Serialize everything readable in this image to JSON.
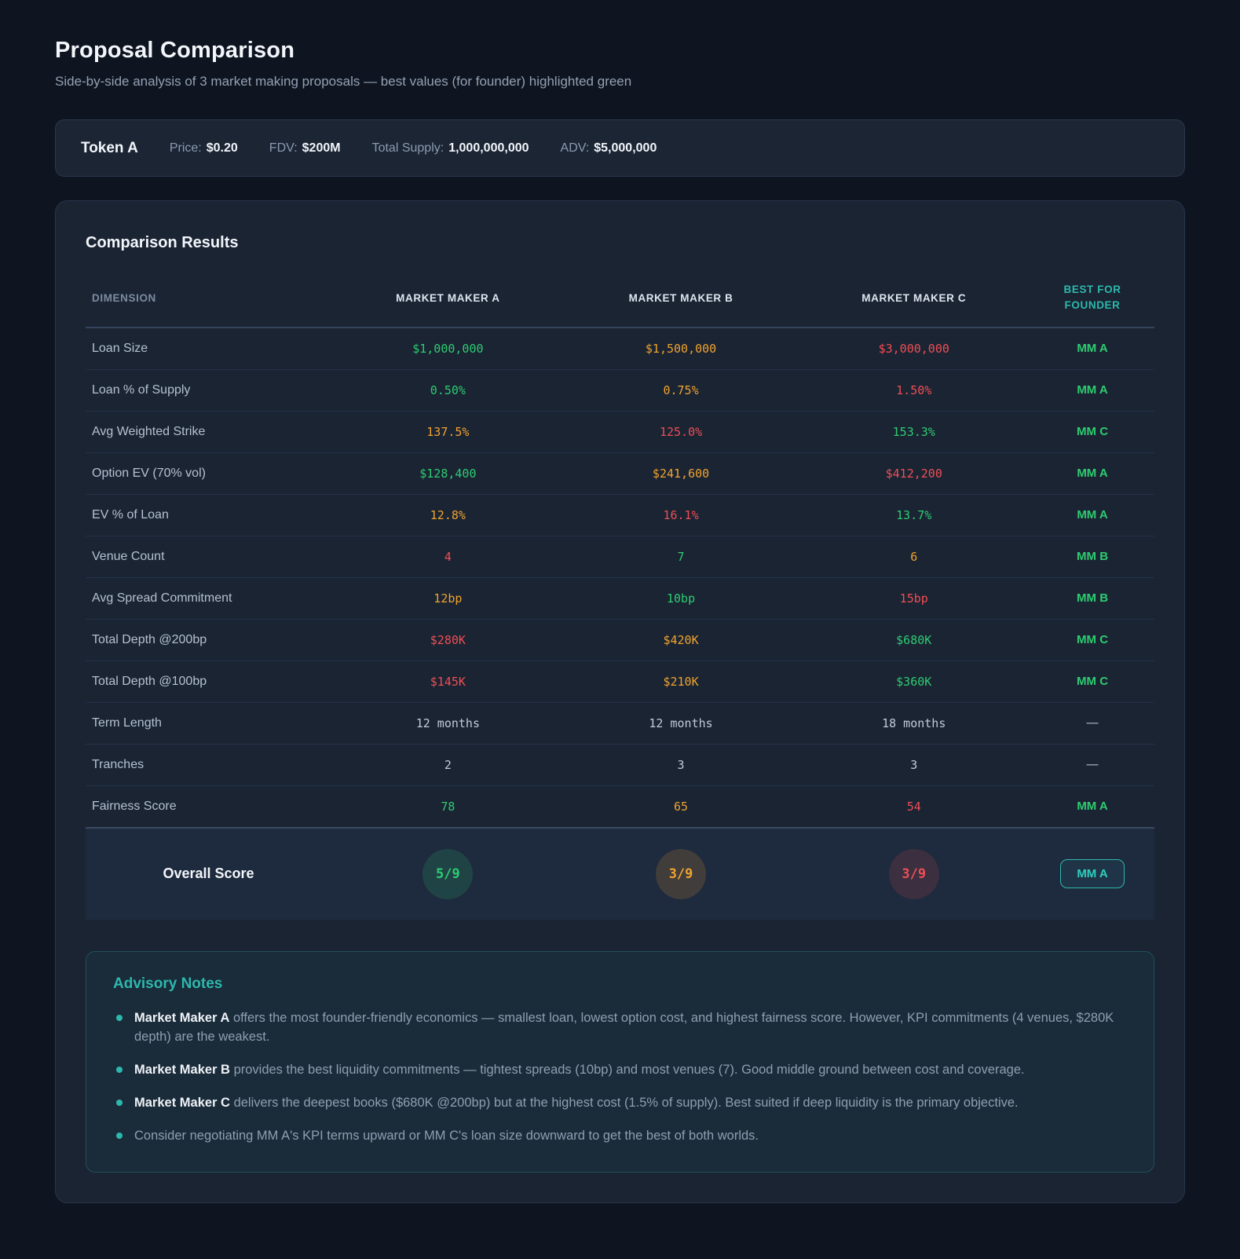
{
  "page": {
    "title": "Proposal Comparison",
    "subtitle": "Side-by-side analysis of 3 market making proposals — best values (for founder) highlighted green"
  },
  "token_bar": {
    "name": "Token A",
    "stats": [
      {
        "label": "Price:",
        "value": "$0.20"
      },
      {
        "label": "FDV:",
        "value": "$200M"
      },
      {
        "label": "Total Supply:",
        "value": "1,000,000,000"
      },
      {
        "label": "ADV:",
        "value": "$5,000,000"
      }
    ]
  },
  "comparison": {
    "title": "Comparison Results",
    "columns": [
      "DIMENSION",
      "MARKET MAKER A",
      "MARKET MAKER B",
      "MARKET MAKER C",
      "BEST FOR FOUNDER"
    ],
    "rows": [
      {
        "dimension": "Loan Size",
        "values": [
          {
            "text": "$1,000,000",
            "color": "green"
          },
          {
            "text": "$1,500,000",
            "color": "orange"
          },
          {
            "text": "$3,000,000",
            "color": "red"
          }
        ],
        "best": {
          "text": "MM A",
          "color": "green"
        }
      },
      {
        "dimension": "Loan % of Supply",
        "values": [
          {
            "text": "0.50%",
            "color": "green"
          },
          {
            "text": "0.75%",
            "color": "orange"
          },
          {
            "text": "1.50%",
            "color": "red"
          }
        ],
        "best": {
          "text": "MM A",
          "color": "green"
        }
      },
      {
        "dimension": "Avg Weighted Strike",
        "values": [
          {
            "text": "137.5%",
            "color": "orange"
          },
          {
            "text": "125.0%",
            "color": "red"
          },
          {
            "text": "153.3%",
            "color": "green"
          }
        ],
        "best": {
          "text": "MM C",
          "color": "green"
        }
      },
      {
        "dimension": "Option EV (70% vol)",
        "values": [
          {
            "text": "$128,400",
            "color": "green"
          },
          {
            "text": "$241,600",
            "color": "orange"
          },
          {
            "text": "$412,200",
            "color": "red"
          }
        ],
        "best": {
          "text": "MM A",
          "color": "green"
        }
      },
      {
        "dimension": "EV % of Loan",
        "values": [
          {
            "text": "12.8%",
            "color": "orange"
          },
          {
            "text": "16.1%",
            "color": "red"
          },
          {
            "text": "13.7%",
            "color": "green"
          }
        ],
        "best": {
          "text": "MM A",
          "color": "green"
        }
      },
      {
        "dimension": "Venue Count",
        "values": [
          {
            "text": "4",
            "color": "red"
          },
          {
            "text": "7",
            "color": "green"
          },
          {
            "text": "6",
            "color": "orange"
          }
        ],
        "best": {
          "text": "MM B",
          "color": "green"
        }
      },
      {
        "dimension": "Avg Spread Commitment",
        "values": [
          {
            "text": "12bp",
            "color": "orange"
          },
          {
            "text": "10bp",
            "color": "green"
          },
          {
            "text": "15bp",
            "color": "red"
          }
        ],
        "best": {
          "text": "MM B",
          "color": "green"
        }
      },
      {
        "dimension": "Total Depth @200bp",
        "values": [
          {
            "text": "$280K",
            "color": "red"
          },
          {
            "text": "$420K",
            "color": "orange"
          },
          {
            "text": "$680K",
            "color": "green"
          }
        ],
        "best": {
          "text": "MM C",
          "color": "green"
        }
      },
      {
        "dimension": "Total Depth @100bp",
        "values": [
          {
            "text": "$145K",
            "color": "red"
          },
          {
            "text": "$210K",
            "color": "orange"
          },
          {
            "text": "$360K",
            "color": "green"
          }
        ],
        "best": {
          "text": "MM C",
          "color": "green"
        }
      },
      {
        "dimension": "Term Length",
        "values": [
          {
            "text": "12 months",
            "color": "neutral"
          },
          {
            "text": "12 months",
            "color": "neutral"
          },
          {
            "text": "18 months",
            "color": "neutral"
          }
        ],
        "best": {
          "text": "—",
          "color": "muted"
        }
      },
      {
        "dimension": "Tranches",
        "values": [
          {
            "text": "2",
            "color": "neutral"
          },
          {
            "text": "3",
            "color": "neutral"
          },
          {
            "text": "3",
            "color": "neutral"
          }
        ],
        "best": {
          "text": "—",
          "color": "muted"
        }
      },
      {
        "dimension": "Fairness Score",
        "values": [
          {
            "text": "78",
            "color": "green"
          },
          {
            "text": "65",
            "color": "orange"
          },
          {
            "text": "54",
            "color": "red"
          }
        ],
        "best": {
          "text": "MM A",
          "color": "green"
        }
      }
    ],
    "overall": {
      "label": "Overall Score",
      "scores": [
        {
          "text": "5/9",
          "color": "green"
        },
        {
          "text": "3/9",
          "color": "orange"
        },
        {
          "text": "3/9",
          "color": "red"
        }
      ],
      "best_badge": "MM A"
    }
  },
  "advisory": {
    "title": "Advisory Notes",
    "notes": [
      {
        "bold": "Market Maker A",
        "text": " offers the most founder-friendly economics — smallest loan, lowest option cost, and highest fairness score. However, KPI commitments (4 venues, $280K depth) are the weakest."
      },
      {
        "bold": "Market Maker B",
        "text": " provides the best liquidity commitments — tightest spreads (10bp) and most venues (7). Good middle ground between cost and coverage."
      },
      {
        "bold": "Market Maker C",
        "text": " delivers the deepest books ($680K @200bp) but at the highest cost (1.5% of supply). Best suited if deep liquidity is the primary objective."
      },
      {
        "bold": "",
        "text": "Consider negotiating MM A's KPI terms upward or MM C's loan size downward to get the best of both worlds."
      }
    ]
  },
  "colors": {
    "good": "#2ecc71",
    "mid": "#f0a32f",
    "bad": "#ef4e55",
    "accent_teal": "#2db8ad",
    "page_bg": "#0e1520",
    "card_bg": "#1a2433"
  }
}
